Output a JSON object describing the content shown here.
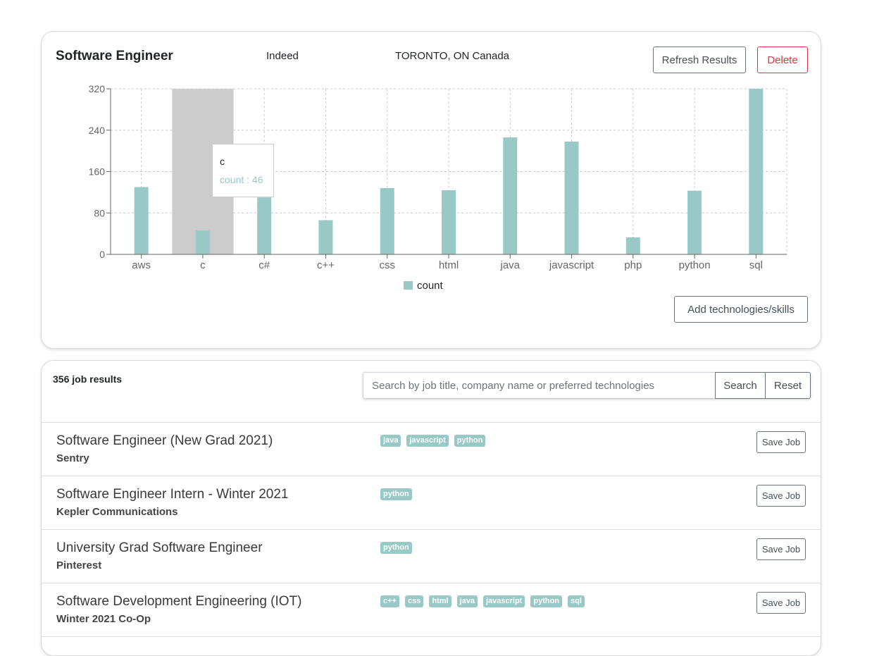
{
  "search": {
    "title": "Software Engineer",
    "site": "Indeed",
    "location": "TORONTO, ON Canada",
    "refresh_label": "Refresh Results",
    "delete_label": "Delete",
    "add_tech_label": "Add technologies/skills",
    "tooltip": {
      "label": "c",
      "value_text": "count : 46"
    }
  },
  "chart_data": {
    "type": "bar",
    "categories": [
      "aws",
      "c",
      "c#",
      "c++",
      "css",
      "html",
      "java",
      "javascript",
      "php",
      "python",
      "sql"
    ],
    "series": [
      {
        "name": "count",
        "values": [
          130,
          46,
          110,
          66,
          128,
          124,
          226,
          218,
          33,
          123,
          320
        ]
      }
    ],
    "yticks": [
      0,
      80,
      160,
      240,
      320
    ],
    "ylim": [
      0,
      320
    ],
    "grid": true,
    "legend": "bottom",
    "highlighted_category": "c",
    "colors": {
      "bar": "#99c9c7",
      "highlight": "#cccccc"
    }
  },
  "results": {
    "count_text": "356 job results",
    "search_placeholder": "Search by job title, company name or preferred technologies",
    "search_label": "Search",
    "reset_label": "Reset",
    "save_label": "Save Job",
    "jobs": [
      {
        "title": "Software Engineer (New Grad 2021)",
        "company": "Sentry",
        "tags": [
          "java",
          "javascript",
          "python"
        ]
      },
      {
        "title": "Software Engineer Intern - Winter 2021",
        "company": "Kepler Communications",
        "tags": [
          "python"
        ]
      },
      {
        "title": "University Grad Software Engineer",
        "company": "Pinterest",
        "tags": [
          "python"
        ]
      },
      {
        "title": "Software Development Engineering (IOT)",
        "company": "Winter 2021 Co-Op",
        "tags": [
          "c++",
          "css",
          "html",
          "java",
          "javascript",
          "python",
          "sql"
        ]
      }
    ]
  }
}
